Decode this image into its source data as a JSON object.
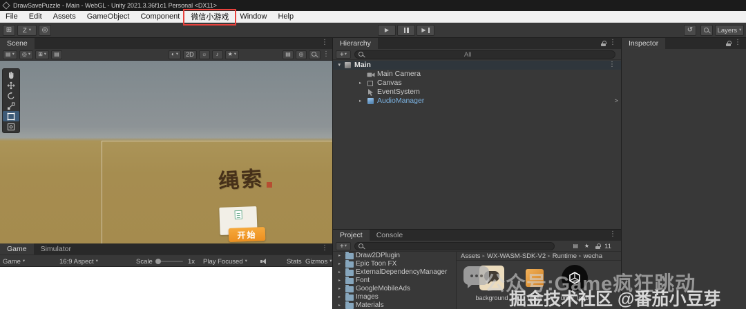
{
  "window": {
    "title": "DrawSavePuzzle - Main - WebGL - Unity 2021.3.36f1c1 Personal <DX11>"
  },
  "menu_bar": {
    "items": [
      "File",
      "Edit",
      "Assets",
      "GameObject",
      "Component",
      "微信小游戏",
      "Window",
      "Help"
    ],
    "highlighted_item": "微信小游戏",
    "annotation_color": "#e8413c"
  },
  "toolbar": {
    "z_label": "Z",
    "layers_label": "Layers"
  },
  "scene": {
    "tab": "Scene",
    "toggle_2d": "2D",
    "calligraphy": "绳索",
    "start_button": "开始"
  },
  "game": {
    "tab": "Game",
    "tab_simulator": "Simulator",
    "display_dropdown": "Game",
    "aspect_dropdown": "16:9 Aspect",
    "scale_label": "Scale",
    "scale_value": "1x",
    "play_focused_dropdown": "Play Focused",
    "stats_button": "Stats",
    "gizmos_dropdown": "Gizmos"
  },
  "hierarchy": {
    "tab": "Hierarchy",
    "search_filter": "All",
    "items": [
      {
        "label": "Main",
        "type": "scene"
      },
      {
        "label": "Main Camera",
        "type": "camera"
      },
      {
        "label": "Canvas",
        "type": "canvas"
      },
      {
        "label": "EventSystem",
        "type": "event-system"
      },
      {
        "label": "AudioManager",
        "type": "prefab",
        "text_color": "#7bb1e0"
      }
    ]
  },
  "inspector": {
    "tab": "Inspector"
  },
  "project": {
    "tab": "Project",
    "tab_console": "Console",
    "hidden_count": "11",
    "folders": [
      "Draw2DPlugin",
      "Epic Toon FX",
      "ExternalDependencyManager",
      "Font",
      "GoogleMobileAds",
      "Images",
      "Materials"
    ],
    "breadcrumb": [
      "Assets",
      "WX-WASM-SDK-V2",
      "Runtime",
      "wecha"
    ],
    "assets": [
      "background",
      "open",
      "unity_logo"
    ]
  },
  "watermark": {
    "big": "公众号:Game疯狂跳动",
    "small": "掘金技术社区 @番茄小豆芽"
  },
  "colors": {
    "accent_blue": "#7bb1e0",
    "annotation_red": "#e8413c",
    "start_orange": "#ec8f1f"
  },
  "icons": {
    "caret": "▾",
    "kebab": "⋮",
    "plus": "+",
    "play": "▶",
    "arrow_open": "▼",
    "arrow_closed": "▸",
    "undo": "↺",
    "grid": "⊞",
    "rows": "▤",
    "circle": "◎",
    "sphere": "◐",
    "sun": "☼",
    "note": "♪",
    "star": "★",
    "sep": "▸",
    "prefab_arrow": ">"
  }
}
